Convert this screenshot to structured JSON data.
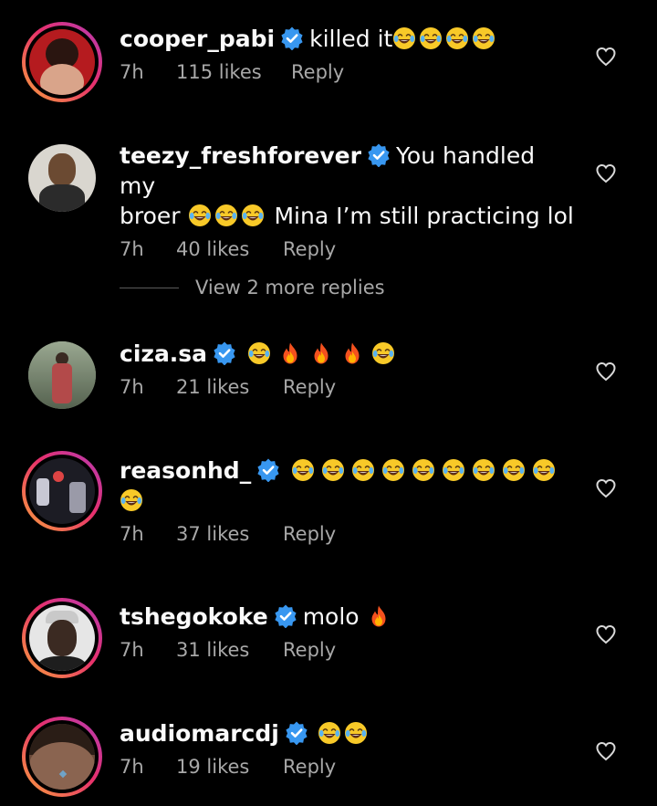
{
  "comments": [
    {
      "username": "cooper_pabi",
      "text": "killed it",
      "emojis": [
        "joy",
        "joy",
        "joy",
        "joy"
      ],
      "time": "7h",
      "likes": "115 likes",
      "reply": "Reply",
      "avatar": {
        "bg": "#b51b1f",
        "fg": "#2a1510",
        "ring": true
      }
    },
    {
      "username": "teezy_freshforever",
      "text_line1": "You handled my",
      "text_line2_lead": "broer",
      "text_line2_emojis": [
        "joy",
        "joy",
        "joy"
      ],
      "text_line2_tail": "Mina I’m still practicing lol",
      "time": "7h",
      "likes": "40 likes",
      "reply": "Reply",
      "avatar": {
        "bg": "#d9d6cf",
        "fg": "#6b4a32",
        "ring": false
      }
    },
    {
      "username": "ciza.sa",
      "emojis": [
        "joy",
        "fire",
        "fire",
        "fire",
        "joy"
      ],
      "time": "7h",
      "likes": "21 likes",
      "reply": "Reply",
      "avatar": {
        "bg": "#7d8b74",
        "fg": "#b34a4a",
        "ring": false
      }
    },
    {
      "username": "reasonhd_",
      "emojis": [
        "joy",
        "joy",
        "joy",
        "joy",
        "joy",
        "joy",
        "joy",
        "joy",
        "joy",
        "joy"
      ],
      "time": "7h",
      "likes": "37 likes",
      "reply": "Reply",
      "avatar": {
        "bg": "#1c1c24",
        "fg": "#c8c8d4",
        "ring": true
      }
    },
    {
      "username": "tshegokoke",
      "text": "molo",
      "emojis": [
        "fire"
      ],
      "time": "7h",
      "likes": "31 likes",
      "reply": "Reply",
      "avatar": {
        "bg": "#e6e6e6",
        "fg": "#3b2a22",
        "ring": true
      }
    },
    {
      "username": "audiomarcdj",
      "emojis": [
        "joy",
        "joy"
      ],
      "time": "7h",
      "likes": "19 likes",
      "reply": "Reply",
      "avatar": {
        "bg": "#6a4a3a",
        "fg": "#2a1d16",
        "ring": true
      }
    }
  ],
  "view_more_replies": "View 2 more replies",
  "colors": {
    "background": "#000000",
    "verified": "#3897f0",
    "secondary_text": "#a8a8a8"
  },
  "icons": {
    "verified": "verified-badge-icon",
    "like": "heart-outline-icon",
    "joy": "face-tears-of-joy-emoji",
    "fire": "fire-emoji"
  }
}
